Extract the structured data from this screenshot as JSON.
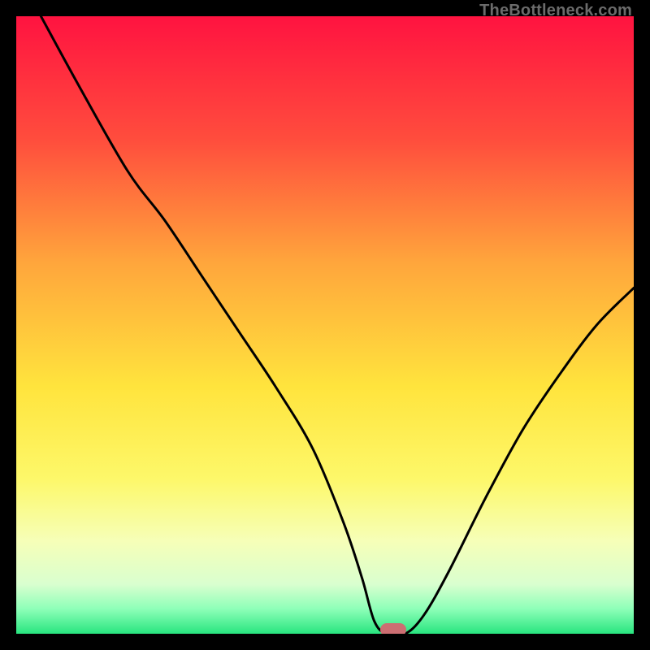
{
  "watermark": "TheBottleneck.com",
  "marker": {
    "color": "#cc6e72",
    "x_pct": 61,
    "y_pct": 99.4
  },
  "chart_data": {
    "type": "line",
    "title": "",
    "xlabel": "",
    "ylabel": "",
    "xlim": [
      0,
      100
    ],
    "ylim": [
      0,
      100
    ],
    "grid": false,
    "background_gradient": {
      "stops": [
        {
          "pct": 0,
          "color": "#ff1340"
        },
        {
          "pct": 20,
          "color": "#ff4d3d"
        },
        {
          "pct": 40,
          "color": "#ffa63c"
        },
        {
          "pct": 60,
          "color": "#ffe43d"
        },
        {
          "pct": 75,
          "color": "#fdf86a"
        },
        {
          "pct": 85,
          "color": "#f6ffb8"
        },
        {
          "pct": 92,
          "color": "#d9ffcf"
        },
        {
          "pct": 96,
          "color": "#8dffb8"
        },
        {
          "pct": 100,
          "color": "#28e57f"
        }
      ]
    },
    "series": [
      {
        "name": "bottleneck-curve",
        "color": "#000000",
        "x": [
          4,
          10,
          18,
          24,
          30,
          36,
          42,
          48,
          53,
          56,
          58,
          60,
          63,
          66,
          70,
          76,
          82,
          88,
          94,
          100
        ],
        "y": [
          100,
          89,
          75,
          67,
          58,
          49,
          40,
          30,
          18,
          9,
          2,
          0,
          0,
          3,
          10,
          22,
          33,
          42,
          50,
          56
        ]
      }
    ],
    "marker_point": {
      "x": 61,
      "y": 0
    }
  }
}
